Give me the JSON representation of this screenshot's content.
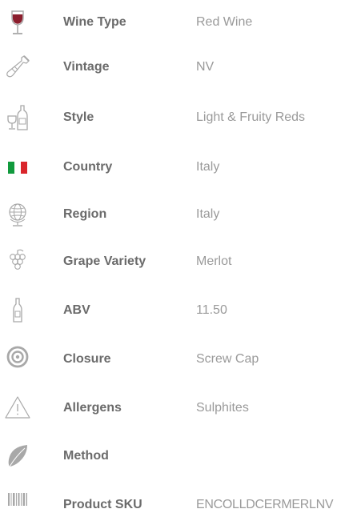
{
  "specs": [
    {
      "label": "Wine Type",
      "value": "Red Wine",
      "icon": "wine-glass-icon"
    },
    {
      "label": "Vintage",
      "value": "NV",
      "icon": "wine-bottle-icon"
    },
    {
      "label": "Style",
      "value": "Light & Fruity Reds",
      "icon": "bottle-and-glass-icon"
    },
    {
      "label": "Country",
      "value": "Italy",
      "icon": "italy-flag-icon"
    },
    {
      "label": "Region",
      "value": "Italy",
      "icon": "globe-icon"
    },
    {
      "label": "Grape Variety",
      "value": "Merlot",
      "icon": "grapes-icon"
    },
    {
      "label": "ABV",
      "value": "11.50",
      "icon": "bottle-icon"
    },
    {
      "label": "Closure",
      "value": "Screw Cap",
      "icon": "target-icon"
    },
    {
      "label": "Allergens",
      "value": "Sulphites",
      "icon": "warning-icon"
    },
    {
      "label": "Method",
      "value": "",
      "icon": "leaf-icon"
    },
    {
      "label": "Product SKU",
      "value": "ENCOLLDCERMERLNV",
      "icon": "barcode-icon"
    }
  ],
  "colors": {
    "label": "#6b6b6b",
    "value": "#9a9a9a",
    "icon_gray": "#a8a8a8",
    "wine_red": "#8b1e2d",
    "flag_green": "#119a3d",
    "flag_red": "#d9252b"
  }
}
